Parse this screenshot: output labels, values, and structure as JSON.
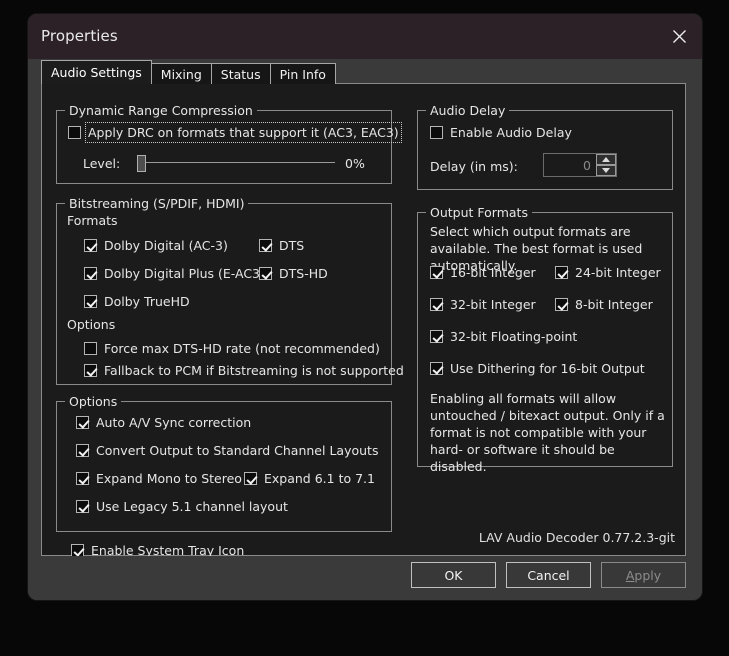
{
  "window": {
    "title": "Properties",
    "close_icon": "close-icon"
  },
  "tabs": [
    {
      "label": "Audio Settings",
      "selected": true
    },
    {
      "label": "Mixing",
      "selected": false
    },
    {
      "label": "Status",
      "selected": false
    },
    {
      "label": "Pin Info",
      "selected": false
    }
  ],
  "dynamic_range_compression": {
    "legend": "Dynamic Range Compression",
    "apply_drc": {
      "label": "Apply DRC on formats that support it (AC3, EAC3)",
      "checked": false,
      "focused": true
    },
    "level_label": "Level:",
    "level_value": "0%",
    "level_percent": 0
  },
  "bitstreaming": {
    "legend": "Bitstreaming (S/PDIF, HDMI)",
    "formats_label": "Formats",
    "formats": [
      {
        "label": "Dolby Digital (AC-3)",
        "checked": true
      },
      {
        "label": "DTS",
        "checked": true
      },
      {
        "label": "Dolby Digital Plus (E-AC3)",
        "checked": true
      },
      {
        "label": "DTS-HD",
        "checked": true
      },
      {
        "label": "Dolby TrueHD",
        "checked": true
      }
    ],
    "options_label": "Options",
    "options": [
      {
        "label": "Force max DTS-HD rate (not recommended)",
        "checked": false
      },
      {
        "label": "Fallback to PCM if Bitstreaming is not supported",
        "checked": true
      }
    ]
  },
  "options": {
    "legend": "Options",
    "items": [
      {
        "label": "Auto A/V Sync correction",
        "checked": true
      },
      {
        "label": "Convert Output to Standard Channel Layouts",
        "checked": true
      },
      {
        "label": "Expand Mono to Stereo",
        "checked": true
      },
      {
        "label": "Expand 6.1 to 7.1",
        "checked": true
      },
      {
        "label": "Use Legacy 5.1 channel layout",
        "checked": true
      }
    ]
  },
  "system_tray": {
    "label": "Enable System Tray Icon",
    "checked": true
  },
  "audio_delay": {
    "legend": "Audio Delay",
    "enable": {
      "label": "Enable Audio Delay",
      "checked": false
    },
    "delay_label": "Delay (in ms):",
    "delay_value": "0",
    "spin_up_icon": "chevron-up-icon",
    "spin_down_icon": "chevron-down-icon"
  },
  "output_formats": {
    "legend": "Output Formats",
    "description": "Select which output formats are available. The best format is used automatically.",
    "items": [
      {
        "label": "16-bit Integer",
        "checked": true
      },
      {
        "label": "24-bit Integer",
        "checked": true
      },
      {
        "label": "32-bit Integer",
        "checked": true
      },
      {
        "label": "8-bit Integer",
        "checked": true
      },
      {
        "label": "32-bit Floating-point",
        "checked": true
      },
      {
        "label": "Use Dithering for 16-bit Output",
        "checked": true
      }
    ],
    "note": "Enabling all formats will allow untouched / bitexact output. Only if a format is not compatible with your hard- or software it should be disabled."
  },
  "version_text": "LAV Audio Decoder 0.77.2.3-git",
  "footer": {
    "ok": "OK",
    "cancel": "Cancel",
    "apply_mnemonic": "A",
    "apply_rest": "pply"
  },
  "colors": {
    "titlebar": "#2d2128",
    "window_chrome": "#3a3a3a",
    "content_bg": "#1b1b1b",
    "border": "#8a8a8a",
    "text": "#e6e6e6",
    "disabled_text": "#8c8c8c"
  }
}
